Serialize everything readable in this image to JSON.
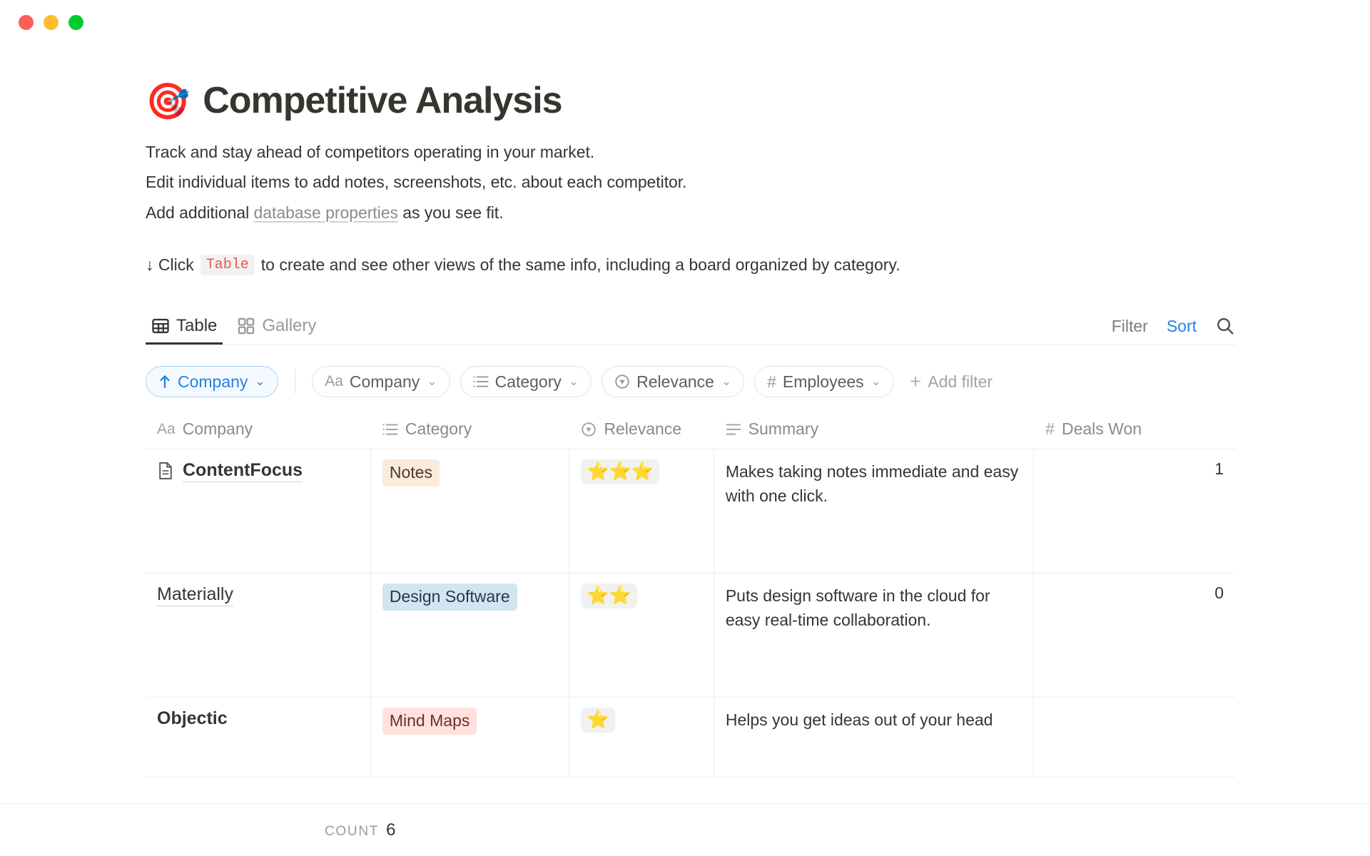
{
  "window": {
    "traffic_lights": [
      {
        "name": "close",
        "color": "#ff5f57"
      },
      {
        "name": "minimize",
        "color": "#ffbd2e"
      },
      {
        "name": "maximize",
        "color": "#00ca2e"
      }
    ]
  },
  "header": {
    "emoji": "🎯",
    "title": "Competitive Analysis"
  },
  "description": {
    "line1": "Track and stay ahead of competitors operating in your market.",
    "line2": "Edit individual items to add notes, screenshots, etc. about each competitor.",
    "line3_prefix": "Add additional ",
    "line3_link": "database properties",
    "line3_suffix": " as you see fit."
  },
  "callout": {
    "prefix": "↓ Click",
    "code": "Table",
    "suffix": "to create and see other views of the same info, including a board organized by category."
  },
  "views": {
    "tabs": [
      {
        "label": "Table",
        "icon": "table-icon",
        "active": true
      },
      {
        "label": "Gallery",
        "icon": "gallery-icon",
        "active": false
      }
    ],
    "actions": {
      "filter": "Filter",
      "sort": "Sort",
      "search_icon": "search-icon",
      "sort_color": "#2383e2"
    }
  },
  "chips": {
    "sort": {
      "label": "Company",
      "icon": "arrow-up-icon",
      "caret": "⌄"
    },
    "properties": [
      {
        "label": "Company",
        "icon": "text-aa-icon",
        "caret": "⌄"
      },
      {
        "label": "Category",
        "icon": "multiselect-icon",
        "caret": "⌄"
      },
      {
        "label": "Relevance",
        "icon": "select-icon",
        "caret": "⌄"
      },
      {
        "label": "Employees",
        "icon": "number-hash-icon",
        "caret": "⌄"
      }
    ],
    "add_filter": "Add filter"
  },
  "table": {
    "columns": [
      {
        "label": "Company",
        "icon": "text-aa-icon",
        "align": "left"
      },
      {
        "label": "Category",
        "icon": "multiselect-icon",
        "align": "left"
      },
      {
        "label": "Relevance",
        "icon": "select-icon",
        "align": "left"
      },
      {
        "label": "Summary",
        "icon": "text-lines-icon",
        "align": "left"
      },
      {
        "label": "Deals Won",
        "icon": "number-hash-icon",
        "align": "right"
      }
    ],
    "rows": [
      {
        "company": "ContentFocus",
        "company_bold": true,
        "category": "Notes",
        "category_bg": "#faebdd",
        "category_fg": "#4c3a21",
        "relevance": "⭐⭐⭐",
        "relevance_stars": 3,
        "summary": "Makes taking notes immediate and easy with one click.",
        "deals_won": "1"
      },
      {
        "company": "Materially",
        "company_bold": false,
        "category": "Design Software",
        "category_bg": "#d3e5ef",
        "category_fg": "#1c3a52",
        "relevance": "⭐⭐",
        "relevance_stars": 2,
        "summary": "Puts design software in the cloud for easy real-time collaboration.",
        "deals_won": "0"
      },
      {
        "company": "Objectic",
        "company_bold": true,
        "category": "Mind Maps",
        "category_bg": "#ffe2dd",
        "category_fg": "#6e2e29",
        "relevance": "⭐",
        "relevance_stars": 1,
        "summary": "Helps you get ideas out of your head",
        "deals_won": ""
      }
    ]
  },
  "footer": {
    "count_label": "Count",
    "count_value": "6"
  }
}
